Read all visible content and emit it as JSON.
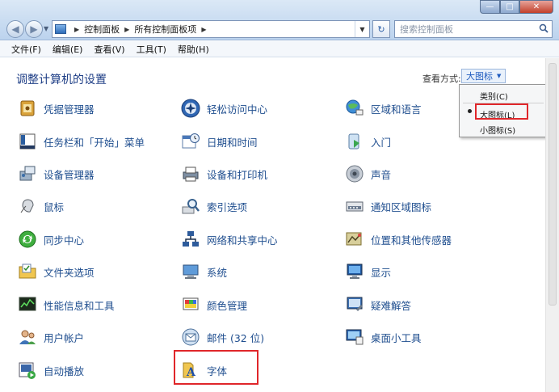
{
  "window": {
    "controls": {
      "minimize": "—",
      "maximize": "□",
      "close": "✕"
    }
  },
  "address_bar": {
    "crumbs": [
      "控制面板",
      "所有控制面板项"
    ],
    "search_placeholder": "搜索控制面板"
  },
  "menu": [
    "文件(F)",
    "编辑(E)",
    "查看(V)",
    "工具(T)",
    "帮助(H)"
  ],
  "page": {
    "title": "调整计算机的设置",
    "view_label": "查看方式:",
    "view_value": "大图标"
  },
  "view_dropdown": {
    "options": [
      "类别(C)",
      "大图标(L)",
      "小图标(S)"
    ],
    "selected": "大图标(L)"
  },
  "items": [
    {
      "label": "凭据管理器",
      "icon": "credential-manager-icon"
    },
    {
      "label": "轻松访问中心",
      "icon": "ease-of-access-icon"
    },
    {
      "label": "区域和语言",
      "icon": "region-language-icon"
    },
    {
      "label": "任务栏和「开始」菜单",
      "icon": "taskbar-icon"
    },
    {
      "label": "日期和时间",
      "icon": "calendar-clock-icon"
    },
    {
      "label": "入门",
      "icon": "getting-started-icon"
    },
    {
      "label": "设备管理器",
      "icon": "device-manager-icon"
    },
    {
      "label": "设备和打印机",
      "icon": "printer-icon"
    },
    {
      "label": "声音",
      "icon": "speaker-icon"
    },
    {
      "label": "鼠标",
      "icon": "mouse-icon"
    },
    {
      "label": "索引选项",
      "icon": "indexing-icon"
    },
    {
      "label": "通知区域图标",
      "icon": "notification-area-icon"
    },
    {
      "label": "同步中心",
      "icon": "sync-icon"
    },
    {
      "label": "网络和共享中心",
      "icon": "network-icon"
    },
    {
      "label": "位置和其他传感器",
      "icon": "location-sensor-icon"
    },
    {
      "label": "文件夹选项",
      "icon": "folder-options-icon"
    },
    {
      "label": "系统",
      "icon": "system-icon"
    },
    {
      "label": "显示",
      "icon": "display-icon"
    },
    {
      "label": "性能信息和工具",
      "icon": "performance-icon"
    },
    {
      "label": "颜色管理",
      "icon": "color-management-icon"
    },
    {
      "label": "疑难解答",
      "icon": "troubleshooting-icon"
    },
    {
      "label": "用户帐户",
      "icon": "user-accounts-icon"
    },
    {
      "label": "邮件 (32 位)",
      "icon": "mail-icon"
    },
    {
      "label": "桌面小工具",
      "icon": "gadgets-icon"
    },
    {
      "label": "自动播放",
      "icon": "autoplay-icon"
    },
    {
      "label": "字体",
      "icon": "fonts-icon"
    }
  ],
  "colors": {
    "link_text": "#1f4e8f",
    "title_text": "#1e3e86",
    "highlight_box": "#e0262a"
  }
}
